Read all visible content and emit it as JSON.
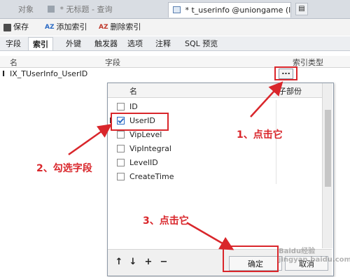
{
  "window_tabs": [
    {
      "label": "对象"
    },
    {
      "label": "* 无标题 - 查询"
    },
    {
      "label": "* t_userinfo @uniongame (l..."
    }
  ],
  "toolbar": {
    "save": "保存",
    "add_index": "添加索引",
    "delete_index": "删除索引"
  },
  "sub_tabs": [
    "字段",
    "索引",
    "外键",
    "触发器",
    "选项",
    "注释",
    "SQL 预览"
  ],
  "index_grid": {
    "headers": {
      "name": "名",
      "fields": "字段",
      "index_type": "索引类型"
    },
    "row": {
      "name": "IX_TUserInfo_UserID",
      "fields_button": "..."
    }
  },
  "field_dialog": {
    "headers": {
      "name": "名",
      "sub_part": "子部份"
    },
    "fields": [
      {
        "name": "ID",
        "checked": false
      },
      {
        "name": "UserID",
        "checked": true
      },
      {
        "name": "VipLevel",
        "checked": false
      },
      {
        "name": "VipIntegral",
        "checked": false
      },
      {
        "name": "LevelID",
        "checked": false
      },
      {
        "name": "CreateTime",
        "checked": false
      }
    ],
    "controls": {
      "up": "↑",
      "down": "↓",
      "add": "+",
      "remove": "−"
    },
    "ok": "确定",
    "cancel": "取消"
  },
  "annotations": {
    "step1": "1、点击它",
    "step2": "2、勾选字段",
    "step3": "3、点击它"
  },
  "watermark": "Baidu经验 jingyan.baidu.com",
  "colors": {
    "annotation_red": "#d9262b",
    "check_blue": "#2c6bc4"
  }
}
